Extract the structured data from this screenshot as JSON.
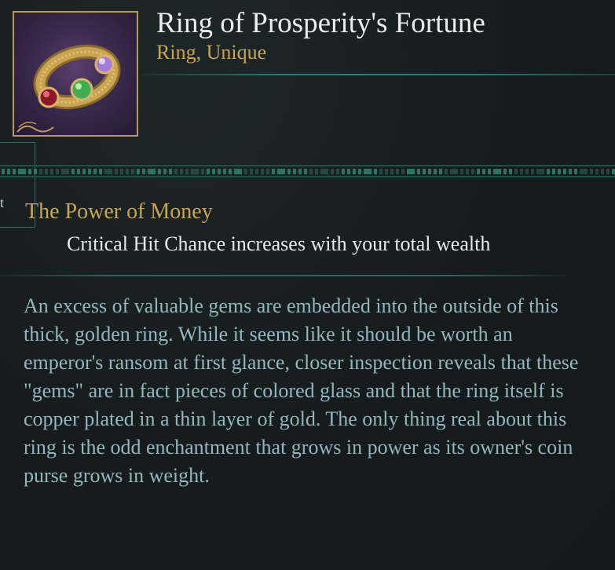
{
  "item": {
    "name": "Ring of Prosperity's Fortune",
    "type": "Ring, Unique",
    "icon": "gem-ring-icon"
  },
  "side_tab": {
    "letter": "t"
  },
  "ability": {
    "title": "The Power of Money",
    "description": "Critical Hit Chance increases with your total wealth"
  },
  "flavor_text": "An excess of valuable gems are embedded into the outside of this thick, golden ring. While it seems like it should be worth an emperor's ransom at first glance, closer inspection reveals that these \"gems\" are in fact pieces of colored glass and that the ring itself is copper plated in a thin layer of gold. The only thing real about this ring is the odd enchantment that grows in power as its owner's coin purse grows in weight.",
  "colors": {
    "background": "#161c1d",
    "title": "#e9ecea",
    "accent_gold": "#c9a552",
    "flavor": "#95b5bf",
    "teal_ornament": "#2e7d6e"
  }
}
